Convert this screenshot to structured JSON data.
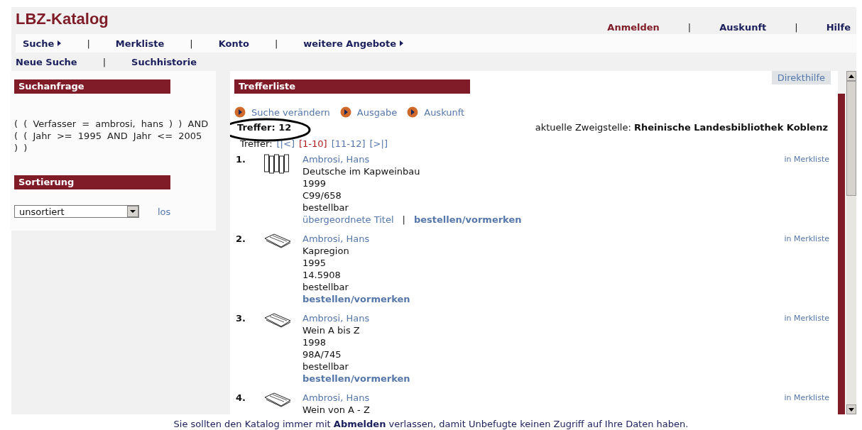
{
  "header": {
    "logo": "LBZ-Katalog",
    "separator": "|",
    "links": [
      {
        "label": "Anmelden",
        "kind": "accent"
      },
      {
        "label": "Auskunft",
        "kind": "plain"
      },
      {
        "label": "Hilfe",
        "kind": "plain"
      }
    ]
  },
  "nav": {
    "separator": "|",
    "items": [
      {
        "label": "Suche",
        "has_arrow": true
      },
      {
        "label": "Merkliste",
        "has_arrow": false
      },
      {
        "label": "Konto",
        "has_arrow": false
      },
      {
        "label": "weitere Angebote",
        "has_arrow": true
      }
    ]
  },
  "subnav": {
    "separator": "|",
    "items": [
      "Neue Suche",
      "Suchhistorie"
    ]
  },
  "sidebar": {
    "query_title": "Suchanfrage",
    "query": "(   (   Verfasser  =  ambrosi, hans  )    )    AND  (    (   Jahr >=  1995  AND Jahr  <=  2005  ) )",
    "sort_title": "Sortierung",
    "sort_value": "unsortiert",
    "sort_go": "los"
  },
  "results": {
    "title": "Trefferliste",
    "help": "Direkthilfe",
    "actions": [
      "Suche verändern",
      "Ausgabe",
      "Auskunft"
    ],
    "count": "Treffer: 12",
    "branch_label": "aktuelle Zweigstelle:",
    "branch": "Rheinische Landesbibliothek Koblenz",
    "paging_label": "Treffer:",
    "pages": [
      {
        "label": "[|<]",
        "selected": false
      },
      {
        "label": "[1-10]",
        "selected": true
      },
      {
        "label": "[11-12]",
        "selected": false
      },
      {
        "label": "[>|]",
        "selected": false
      }
    ],
    "records": [
      {
        "number": "1.",
        "kind": "multivolume",
        "author": "Ambrosi, Hans",
        "lines": [
          "Deutsche im Kapweinbau",
          "1999",
          "C99/658",
          "bestellbar"
        ],
        "links": [
          {
            "label": "übergeordnete Titel",
            "kind": "plain"
          },
          {
            "separator": "|",
            "label": "bestellen/vormerken",
            "kind": "strong"
          }
        ],
        "watch": "in Merkliste"
      },
      {
        "number": "2.",
        "kind": "book",
        "author": "Ambrosi, Hans",
        "lines": [
          "Kapregion",
          "1995",
          "14.5908",
          "bestellbar"
        ],
        "links": [
          {
            "label": "bestellen/vormerken",
            "kind": "strong"
          }
        ],
        "watch": "in Merkliste"
      },
      {
        "number": "3.",
        "kind": "book",
        "author": "Ambrosi, Hans",
        "lines": [
          "Wein A bis Z",
          "1998",
          "98A/745",
          "bestellbar"
        ],
        "links": [
          {
            "label": "bestellen/vormerken",
            "kind": "strong"
          }
        ],
        "watch": "in Merkliste"
      },
      {
        "number": "4.",
        "kind": "book",
        "author": "Ambrosi, Hans",
        "lines": [
          "Wein von A - Z"
        ],
        "watch": "in Merkliste"
      }
    ]
  },
  "footer": "Sie sollten den Katalog immer mit **Abmelden** verlassen, damit Unbefugte keinen Zugriff auf Ihre Daten haben."
}
